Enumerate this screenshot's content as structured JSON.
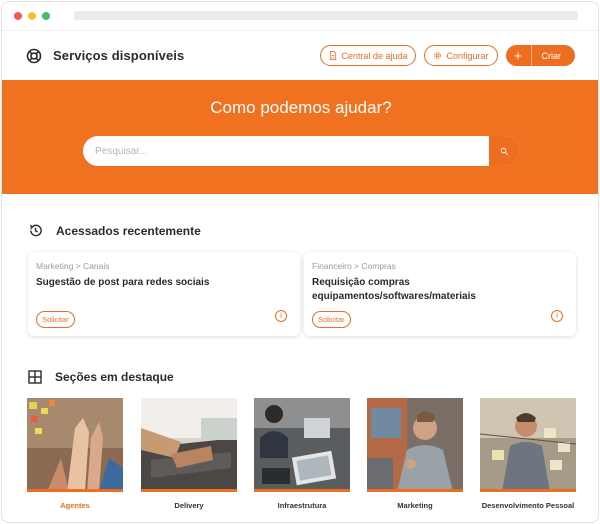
{
  "header": {
    "title": "Serviços disponíveis",
    "help_label": "Central de ajuda",
    "config_label": "Configurar",
    "create_label": "Criar"
  },
  "hero": {
    "title": "Como podemos ajudar?",
    "search_placeholder": "Pesquisar..."
  },
  "recent": {
    "heading": "Acessados recentemente",
    "cards": [
      {
        "breadcrumb": "Marketing > Canais",
        "title": "Sugestão de post para redes sociais",
        "button": "Solicitar"
      },
      {
        "breadcrumb": "Financeiro > Compras",
        "title": "Requisição compras equipamentos/softwares/materiais",
        "button": "Solicitar"
      }
    ]
  },
  "featured": {
    "heading": "Seções em destaque",
    "sections": [
      {
        "label": "Agentes",
        "active": true
      },
      {
        "label": "Delivery",
        "active": false
      },
      {
        "label": "Infraestrutura",
        "active": false
      },
      {
        "label": "Marketing",
        "active": false
      },
      {
        "label": "Desenvolvimento Pessoal",
        "active": false
      }
    ]
  },
  "colors": {
    "accent": "#ee6e21",
    "hero_bg": "#f07220"
  }
}
